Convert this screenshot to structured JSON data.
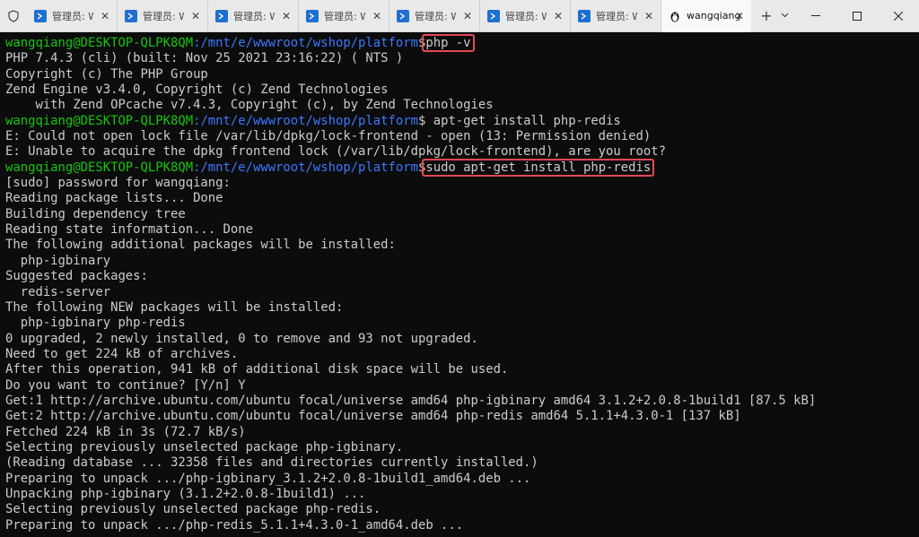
{
  "tabs": [
    {
      "label": "管理员: Wi",
      "active": false
    },
    {
      "label": "管理员: Wi",
      "active": false
    },
    {
      "label": "管理员: Wi",
      "active": false
    },
    {
      "label": "管理员: Wi",
      "active": false
    },
    {
      "label": "管理员: Wi",
      "active": false
    },
    {
      "label": "管理员: Wi",
      "active": false
    },
    {
      "label": "管理员: Wi",
      "active": false
    },
    {
      "label": "wangqiang",
      "active": true
    }
  ],
  "controls": {
    "new_tab": "+",
    "dropdown": "⌄",
    "minimize": "—",
    "maximize": "☐",
    "close": "✕"
  },
  "terminal": {
    "prompt_user": "wangqiang@DESKTOP-QLPK8QM",
    "prompt_path": ":/mnt/e/wwwroot/wshop/platform",
    "prompt_sym": "$",
    "cmd1": "php -v",
    "cmd2": "apt-get install php-redis",
    "cmd3": "sudo apt-get install php-redis",
    "out1": [
      "PHP 7.4.3 (cli) (built: Nov 25 2021 23:16:22) ( NTS )",
      "Copyright (c) The PHP Group",
      "Zend Engine v3.4.0, Copyright (c) Zend Technologies",
      "    with Zend OPcache v7.4.3, Copyright (c), by Zend Technologies"
    ],
    "out2": [
      "E: Could not open lock file /var/lib/dpkg/lock-frontend - open (13: Permission denied)",
      "E: Unable to acquire the dpkg frontend lock (/var/lib/dpkg/lock-frontend), are you root?"
    ],
    "out3": [
      "[sudo] password for wangqiang:",
      "Reading package lists... Done",
      "Building dependency tree",
      "Reading state information... Done",
      "The following additional packages will be installed:",
      "  php-igbinary",
      "Suggested packages:",
      "  redis-server",
      "The following NEW packages will be installed:",
      "  php-igbinary php-redis",
      "0 upgraded, 2 newly installed, 0 to remove and 93 not upgraded.",
      "Need to get 224 kB of archives.",
      "After this operation, 941 kB of additional disk space will be used.",
      "Do you want to continue? [Y/n] Y",
      "Get:1 http://archive.ubuntu.com/ubuntu focal/universe amd64 php-igbinary amd64 3.1.2+2.0.8-1build1 [87.5 kB]",
      "Get:2 http://archive.ubuntu.com/ubuntu focal/universe amd64 php-redis amd64 5.1.1+4.3.0-1 [137 kB]",
      "Fetched 224 kB in 3s (72.7 kB/s)",
      "Selecting previously unselected package php-igbinary.",
      "(Reading database ... 32358 files and directories currently installed.)",
      "Preparing to unpack .../php-igbinary_3.1.2+2.0.8-1build1_amd64.deb ...",
      "Unpacking php-igbinary (3.1.2+2.0.8-1build1) ...",
      "Selecting previously unselected package php-redis.",
      "Preparing to unpack .../php-redis_5.1.1+4.3.0-1_amd64.deb ..."
    ]
  }
}
